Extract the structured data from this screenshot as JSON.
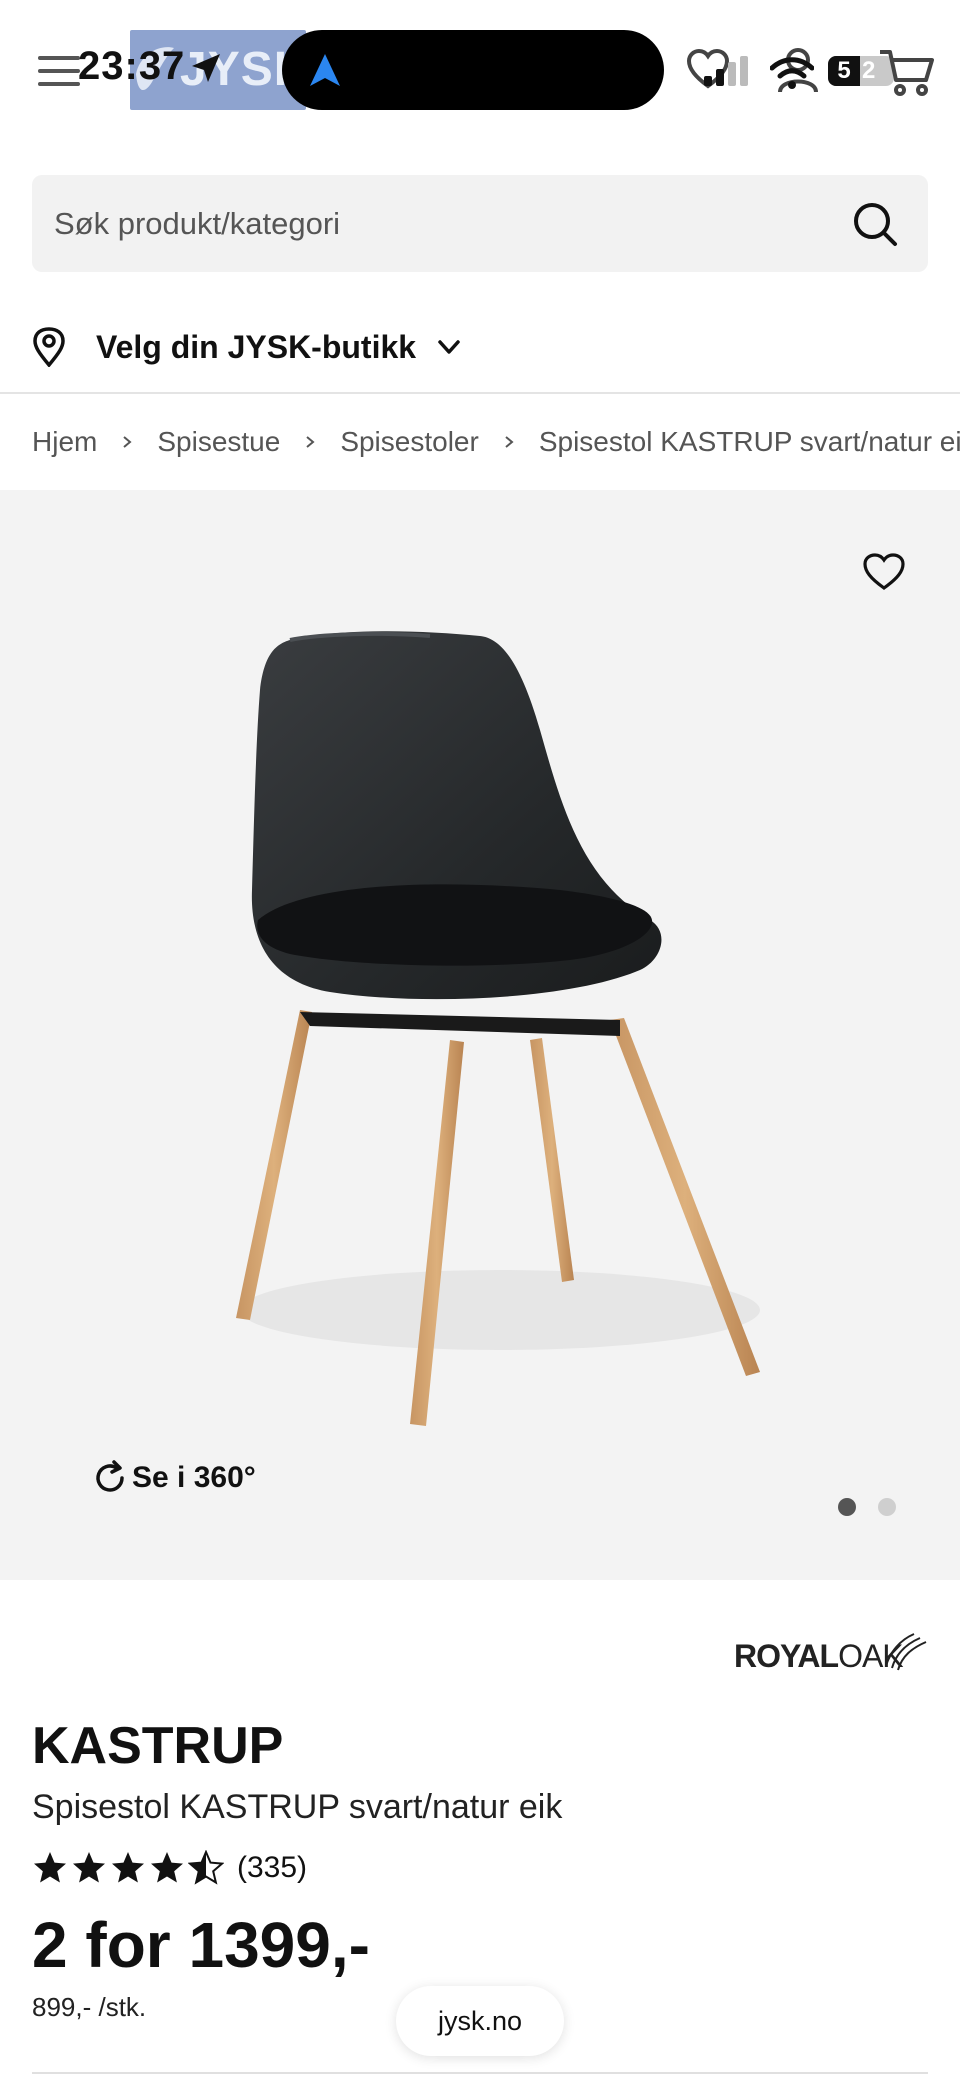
{
  "status_bar": {
    "time": "23:37",
    "battery_level_text": "5",
    "battery_level_text_2": "2"
  },
  "header": {
    "logo_text": "JYSK"
  },
  "search": {
    "placeholder": "Søk produkt/kategori"
  },
  "store": {
    "label": "Velg din JYSK-butikk"
  },
  "breadcrumb": [
    "Hjem",
    "Spisestue",
    "Spisestoler",
    "Spisestol KASTRUP svart/natur eik"
  ],
  "gallery": {
    "rotate_label": "Se i 360°",
    "image_count": 2,
    "active_index": 0
  },
  "product": {
    "brand_royal": "ROYAL",
    "brand_oak": "OAK",
    "name": "KASTRUP",
    "description": "Spisestol KASTRUP svart/natur eik",
    "rating": 4.5,
    "rating_max": 5,
    "rating_count": "(335)",
    "price": "2 for 1399,-",
    "unit_price": "899,- /stk."
  },
  "browser": {
    "url": "jysk.no"
  },
  "colors": {
    "accent": "#2b86f0",
    "logo_bg": "#8ea3cf",
    "gallery_bg": "#f3f3f3"
  }
}
